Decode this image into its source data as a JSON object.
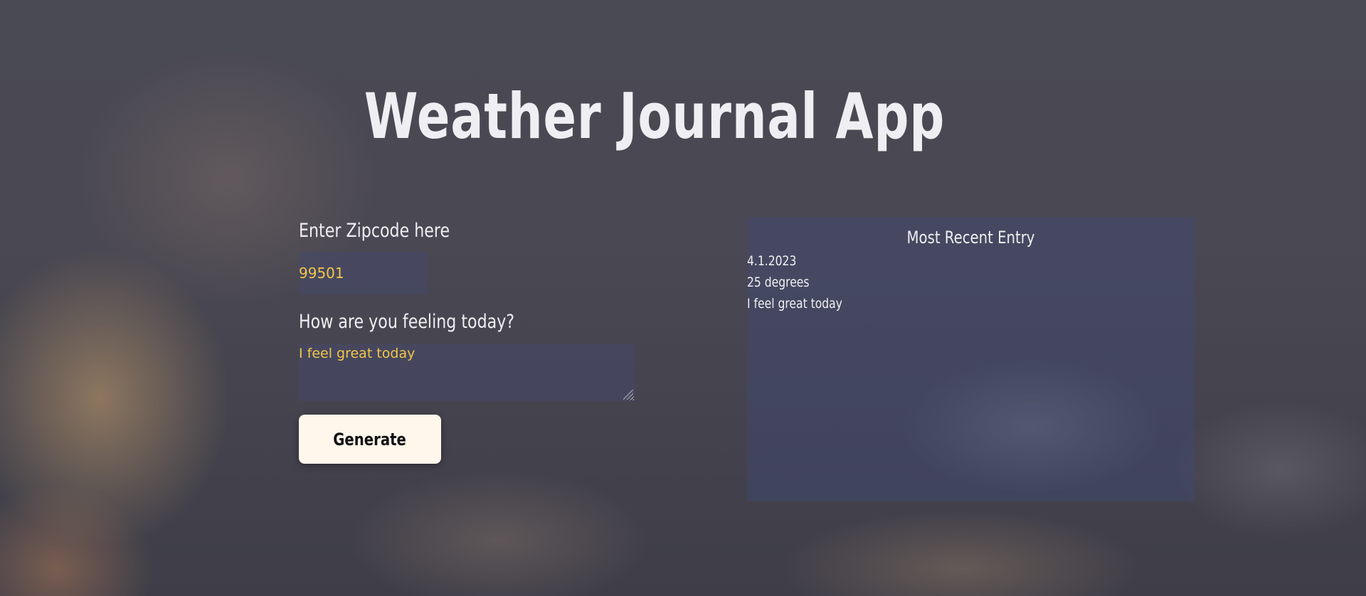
{
  "app": {
    "title": "Weather Journal App"
  },
  "form": {
    "zip_label": "Enter Zipcode here",
    "zip_value": "99501",
    "feelings_label": "How are you feeling today?",
    "feelings_value": "I feel great today",
    "generate_label": "Generate"
  },
  "entry": {
    "heading": "Most Recent Entry",
    "date": "4.1.2023",
    "temp": "25 degrees",
    "content": "I feel great today"
  },
  "colors": {
    "input_text": "#f2c648",
    "button_bg": "#fff6ec",
    "panel_bg": "#3e4a7a",
    "text": "#efeef2"
  }
}
